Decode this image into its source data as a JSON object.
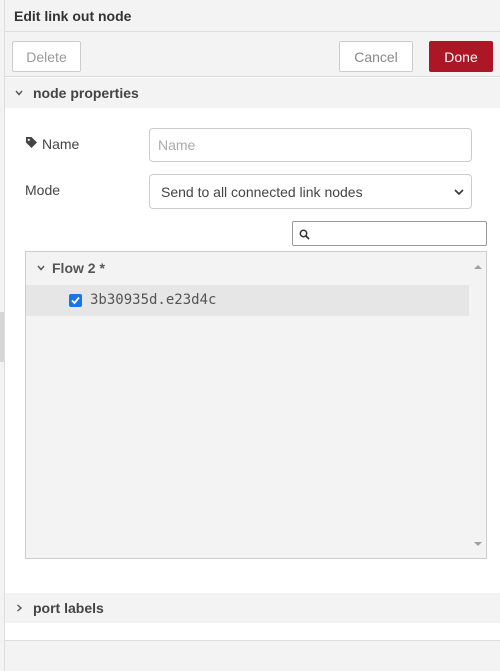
{
  "header": {
    "title": "Edit link out node"
  },
  "toolbar": {
    "delete_label": "Delete",
    "cancel_label": "Cancel",
    "done_label": "Done"
  },
  "sections": {
    "properties_label": "node properties",
    "ports_label": "port labels"
  },
  "form": {
    "name_label": "Name",
    "name_placeholder": "Name",
    "name_value": "",
    "mode_label": "Mode",
    "mode_value": "Send to all connected link nodes"
  },
  "search": {
    "placeholder": ""
  },
  "tree": {
    "group_label": "Flow 2 *",
    "items": [
      {
        "label": "3b30935d.e23d4c",
        "checked": true
      }
    ]
  },
  "colors": {
    "primary": "#ad1625",
    "checkbox": "#1a73e8"
  },
  "icons": [
    "tag-icon",
    "chevron-down-icon",
    "chevron-right-icon",
    "search-icon",
    "check-icon"
  ]
}
